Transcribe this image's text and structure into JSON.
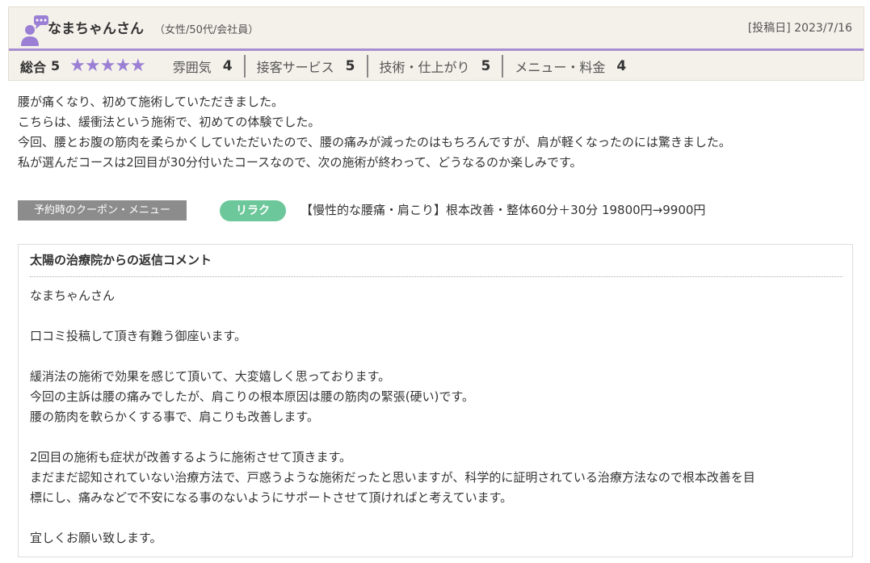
{
  "reviewer": {
    "name": "なまちゃんさん",
    "meta": "（女性/50代/会社員）",
    "post_date": "[投稿日] 2023/7/16"
  },
  "ratings": {
    "overall_label": "総合",
    "overall_score": "5",
    "stars": "★★★★★",
    "star_count": 5,
    "star_color": "#9b7fd4",
    "items": [
      {
        "label": "雰囲気",
        "score": "4"
      },
      {
        "label": "接客サービス",
        "score": "5"
      },
      {
        "label": "技術・仕上がり",
        "score": "5"
      },
      {
        "label": "メニュー・料金",
        "score": "4"
      }
    ]
  },
  "review": {
    "lines": [
      "腰が痛くなり、初めて施術していただきました。",
      "こちらは、緩衝法という施術で、初めての体験でした。",
      "今回、腰とお腹の筋肉を柔らかくしていただいたので、腰の痛みが減ったのはもちろんですが、肩が軽くなったのには驚きました。",
      "私が選んだコースは2回目が30分付いたコースなので、次の施術が終わって、どうなるのか楽しみです。"
    ]
  },
  "coupon": {
    "label": "予約時のクーポン・メニュー",
    "tag": "リラク",
    "tag_color": "#6cc79a",
    "text": "【慢性的な腰痛・肩こり】根本改善・整体60分＋30分 19800円→9900円"
  },
  "reply": {
    "title": "太陽の治療院からの返信コメント",
    "lines": [
      "なまちゃんさん",
      "",
      "口コミ投稿して頂き有難う御座います。",
      "",
      "緩消法の施術で効果を感じて頂いて、大変嬉しく思っております。",
      "今回の主訴は腰の痛みでしたが、肩こりの根本原因は腰の筋肉の緊張(硬い)です。",
      "腰の筋肉を軟らかくする事で、肩こりも改善します。",
      "",
      "2回目の施術も症状が改善するように施術させて頂きます。",
      "まだまだ認知されていない治療方法で、戸惑うような施術だったと思いますが、科学的に証明されている治療方法なので根本改善を目",
      "標にし、痛みなどで不安になる事のないようにサポートさせて頂ければと考えています。",
      "",
      "宜しくお願い致します。"
    ]
  },
  "colors": {
    "accent": "#a78ed0",
    "header_bg": "#f4f1eb",
    "coupon_label_bg": "#8c8c8c"
  }
}
